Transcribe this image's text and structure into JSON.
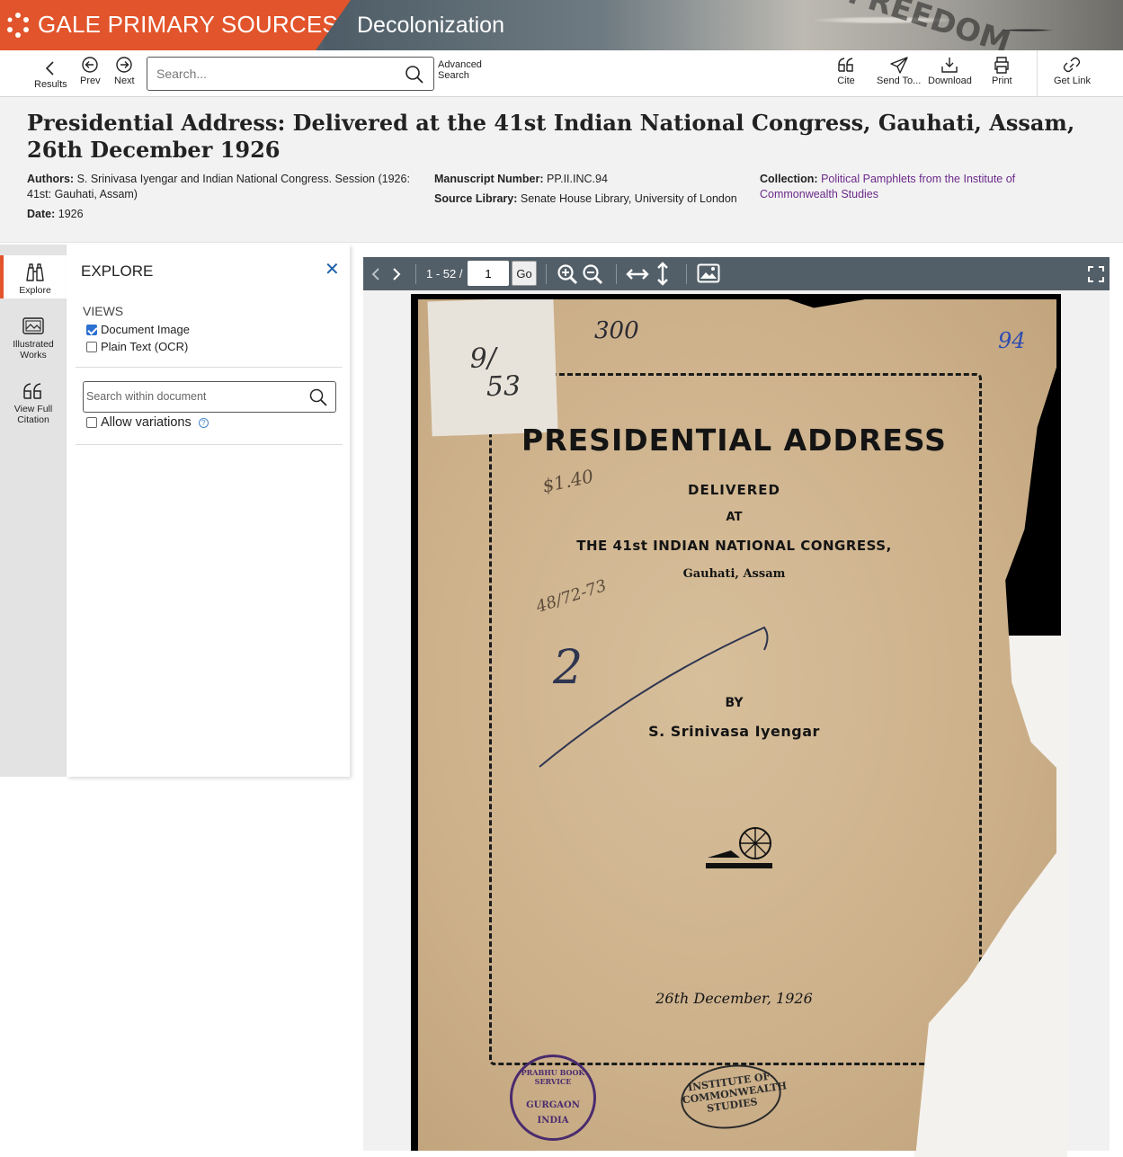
{
  "banner": {
    "brand": "GALE PRIMARY SOURCES",
    "collection": "Decolonization",
    "photo_text": "FREEDOM",
    "brand_color": "#e2542b"
  },
  "toolbar": {
    "results": "Results",
    "prev": "Prev",
    "next": "Next",
    "search_placeholder": "Search...",
    "advanced_line1": "Advanced",
    "advanced_line2": "Search",
    "cite": "Cite",
    "send_to": "Send To...",
    "download": "Download",
    "print": "Print",
    "get_link": "Get Link"
  },
  "document": {
    "title": "Presidential Address: Delivered at the 41st Indian National Congress, Gauhati, Assam, 26th December 1926",
    "authors_label": "Authors:",
    "authors": "S. Srinivasa Iyengar and Indian National Congress. Session (1926: 41st: Gauhati, Assam)",
    "date_label": "Date:",
    "date": "1926",
    "manuscript_label": "Manuscript Number:",
    "manuscript": "PP.II.INC.94",
    "source_label": "Source Library:",
    "source": "Senate House Library, University of London",
    "collection_label": "Collection:",
    "collection": "Political Pamphlets from the Institute of Commonwealth Studies",
    "link_color": "#6b2a8a"
  },
  "rail": {
    "explore": "Explore",
    "illustrated_line1": "Illustrated",
    "illustrated_line2": "Works",
    "citation_line1": "View Full",
    "citation_line2": "Citation"
  },
  "explore_panel": {
    "title": "EXPLORE",
    "close": "✕",
    "views_label": "VIEWS",
    "view_document_image": "Document Image",
    "view_plain_text": "Plain Text (OCR)",
    "search_within_placeholder": "Search within document",
    "allow_variations": "Allow variations",
    "help": "?"
  },
  "viewer": {
    "page_count": "1 - 52 /",
    "page_value": "1",
    "go": "Go"
  },
  "page_image": {
    "heading": "PRESIDENTIAL ADDRESS",
    "delivered": "DELIVERED",
    "at": "AT",
    "congress": "THE 41st INDIAN NATIONAL CONGRESS,",
    "place": "Gauhati, Assam",
    "by": "BY",
    "author": "S. Srinivasa Iyengar",
    "date_line": "26th December, 1926",
    "hw_top": "300",
    "hw_corner": "94",
    "hw_sticker_1": "9/",
    "hw_sticker_2": "53",
    "hw_price": "$1.40",
    "hw_ref": "48/72-73",
    "hw_number": "2",
    "stamp_left_line1": "PRABHU BOOK SERVICE",
    "stamp_left_line2": "GURGAON",
    "stamp_left_line3": "INDIA",
    "stamp_right_line1": "INSTITUTE OF",
    "stamp_right_line2": "COMMONWEALTH",
    "stamp_right_line3": "STUDIES"
  }
}
